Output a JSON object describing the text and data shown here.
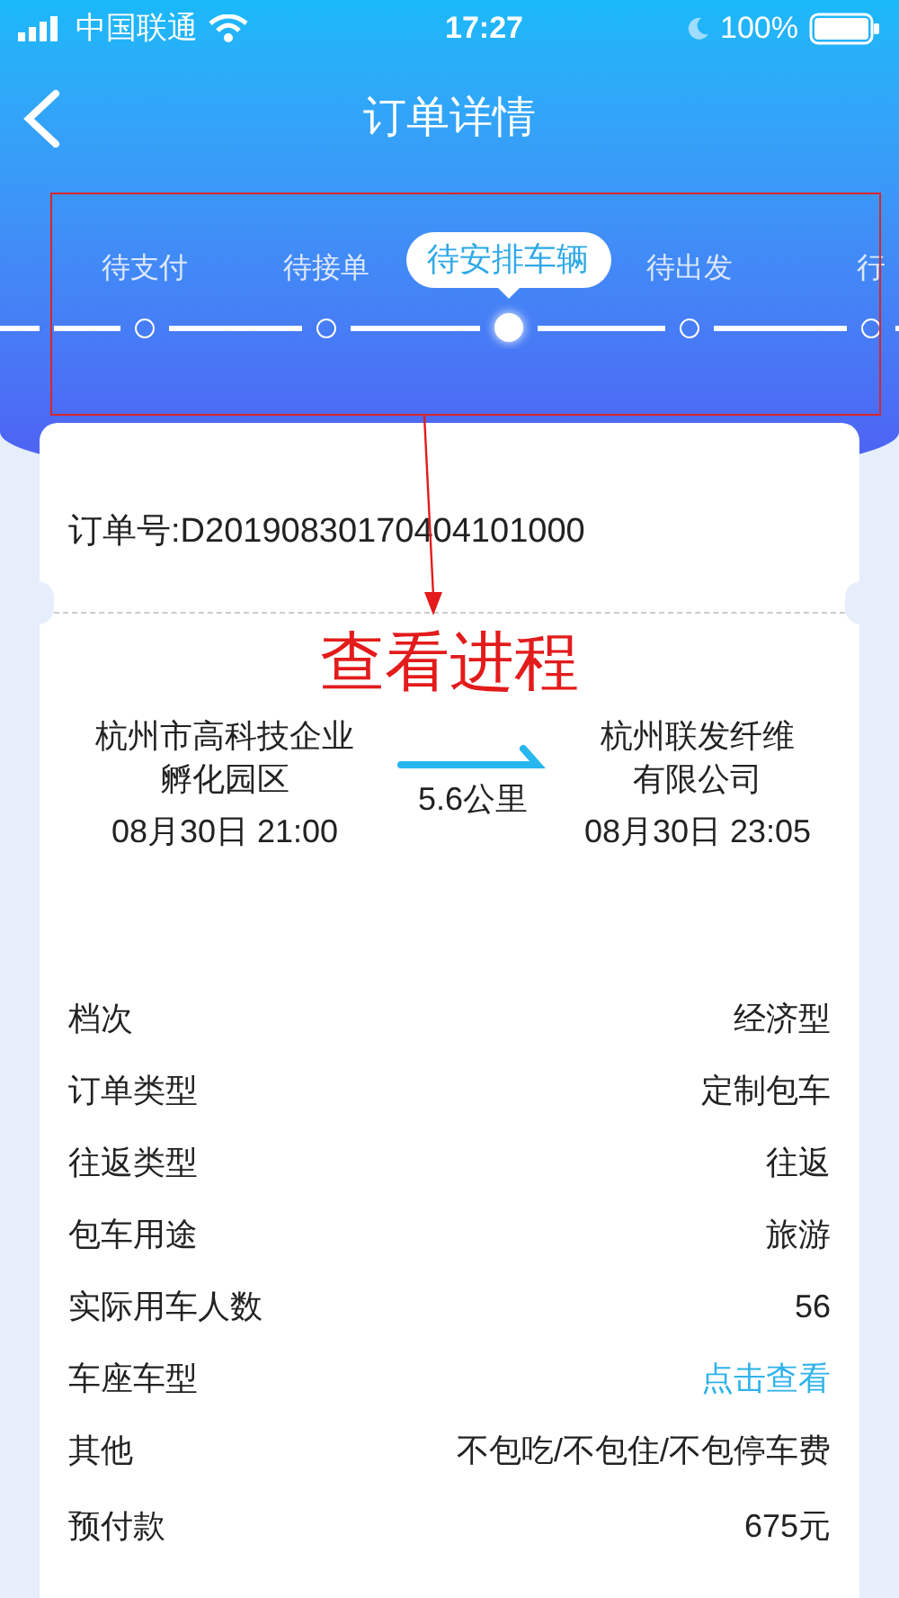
{
  "status_bar": {
    "carrier": "中国联通",
    "time": "17:27",
    "battery": "100%"
  },
  "nav": {
    "title": "订单详情"
  },
  "steps": [
    {
      "label": "待支付",
      "selected": false
    },
    {
      "label": "待接单",
      "selected": false
    },
    {
      "label": "待安排车辆",
      "selected": true
    },
    {
      "label": "待出发",
      "selected": false
    },
    {
      "label": "行",
      "selected": false
    }
  ],
  "order": {
    "number": "订单号:D20190830170404101000"
  },
  "annotation": {
    "text": "查看进程"
  },
  "trip": {
    "from": "杭州市高科技企业孵化园区",
    "from_time": "08月30日 21:00",
    "distance": "5.6公里",
    "to": "杭州联发纤维有限公司",
    "to_time": "08月30日 23:05"
  },
  "details": [
    {
      "label": "档次",
      "value": "经济型",
      "kind": "text"
    },
    {
      "label": "订单类型",
      "value": "定制包车",
      "kind": "text"
    },
    {
      "label": "往返类型",
      "value": "往返",
      "kind": "text"
    },
    {
      "label": "包车用途",
      "value": "旅游",
      "kind": "text"
    },
    {
      "label": "实际用车人数",
      "value": "56",
      "kind": "text"
    },
    {
      "label": "车座车型",
      "value": "点击查看",
      "kind": "link"
    },
    {
      "label": "其他",
      "value": "不包吃/不包住/不包停车费",
      "kind": "text"
    }
  ],
  "payment": {
    "label": "预付款",
    "value": "675元"
  }
}
